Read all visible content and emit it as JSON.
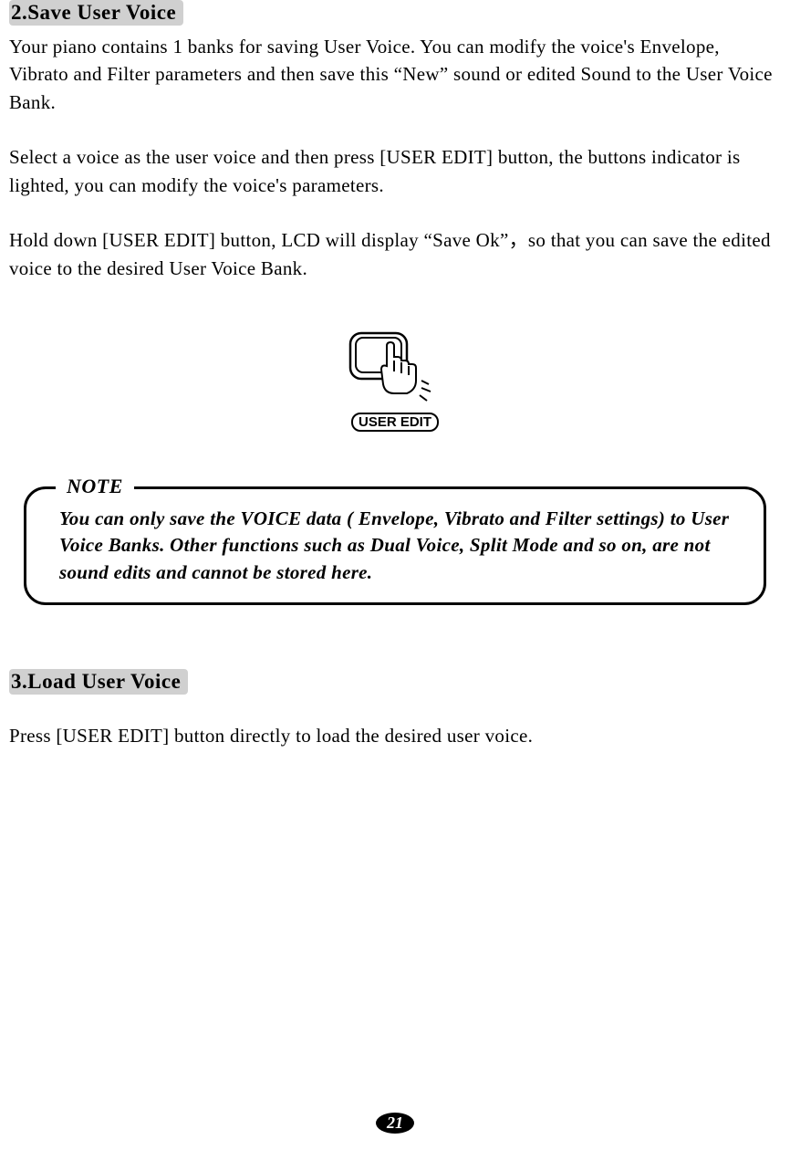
{
  "section2": {
    "heading": "2.Save User Voice",
    "para1": "Your piano contains 1 banks for saving User Voice. You can modify the voice's Envelope, Vibrato and Filter parameters and then save this “New” sound or edited Sound to the User Voice Bank.",
    "para2": "Select a voice as the user voice and then press [USER EDIT] button, the buttons indicator is lighted, you can modify the voice's parameters.",
    "para3": "Hold down [USER EDIT] button, LCD will display “Save Ok”，so that you can save the edited voice to the desired User Voice Bank."
  },
  "button_illustration": {
    "label": "USER EDIT"
  },
  "note": {
    "label": "NOTE",
    "text": "You can only save the VOICE data ( Envelope, Vibrato and Filter settings) to User Voice Banks.  Other functions such as Dual Voice, Split Mode and so on, are not sound edits and cannot be stored here."
  },
  "section3": {
    "heading": "3.Load User Voice",
    "para1": "Press [USER EDIT] button directly to load the desired user voice."
  },
  "page_number": "21"
}
